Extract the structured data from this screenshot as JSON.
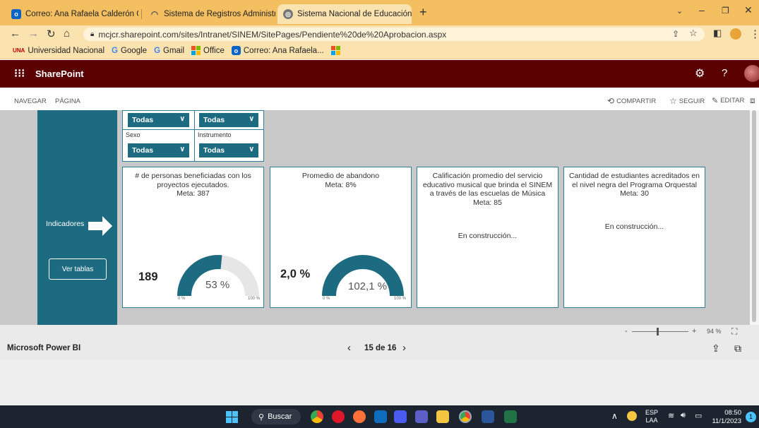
{
  "browser": {
    "tabs": [
      {
        "title": "Correo: Ana Rafaela Calderón Ga",
        "active": false
      },
      {
        "title": "Sistema de Registros Administrat",
        "active": false
      },
      {
        "title": "Sistema Nacional de Educación N",
        "active": true
      }
    ],
    "new_tab": "+",
    "url": "mcjcr.sharepoint.com/sites/Intranet/SINEM/SitePages/Pendiente%20de%20Aprobacion.aspx",
    "bookmarks": [
      "Universidad Nacional",
      "Google",
      "Gmail",
      "Office",
      "Correo: Ana Rafaela..."
    ]
  },
  "sharepoint": {
    "brand": "SharePoint",
    "tabs": [
      "NAVEGAR",
      "PÁGINA"
    ],
    "actions": {
      "share": "COMPARTIR",
      "follow": "SEGUIR",
      "edit": "EDITAR"
    }
  },
  "report": {
    "filters": {
      "top_values": [
        "Todas",
        "Todas"
      ],
      "sexo_label": "Sexo",
      "instrumento_label": "Instrumento",
      "sexo_value": "Todas",
      "instrumento_value": "Todas"
    },
    "left_panel": {
      "indicadores": "Indicadores",
      "ver_tablas": "Ver tablas"
    },
    "cards": [
      {
        "title": "# de personas beneficiadas con los proyectos  ejecutados.",
        "meta": "Meta: 387",
        "value": "189",
        "gauge_label": "53 %",
        "gauge_fraction": 0.53,
        "min": "0 %",
        "max": "100 %"
      },
      {
        "title": "Promedio de abandono",
        "meta": "Meta: 8%",
        "value": "2,0 %",
        "gauge_label": "102,1 %",
        "gauge_fraction": 1.0,
        "min": "0 %",
        "max": "100 %"
      },
      {
        "title": "Calificación promedio del servicio educativo musical que brinda el SINEM a través de las escuelas de Música",
        "meta": "Meta: 85",
        "status": "En construcción..."
      },
      {
        "title": "Cantidad de estudiantes acreditados en el nivel negra del Programa Orquestal",
        "meta": "Meta: 30",
        "status": "En construcción..."
      }
    ],
    "gauge_color": "#1d6b80"
  },
  "powerbi": {
    "brand": "Microsoft Power BI",
    "page_indicator": "15 de 16",
    "zoom": "94 %",
    "zoom_minus": "-",
    "zoom_plus": "+"
  },
  "taskbar": {
    "search": "Buscar",
    "lang_top": "ESP",
    "lang_bottom": "LAA",
    "time": "08:50",
    "date": "11/1/2023",
    "notifications": "1"
  }
}
